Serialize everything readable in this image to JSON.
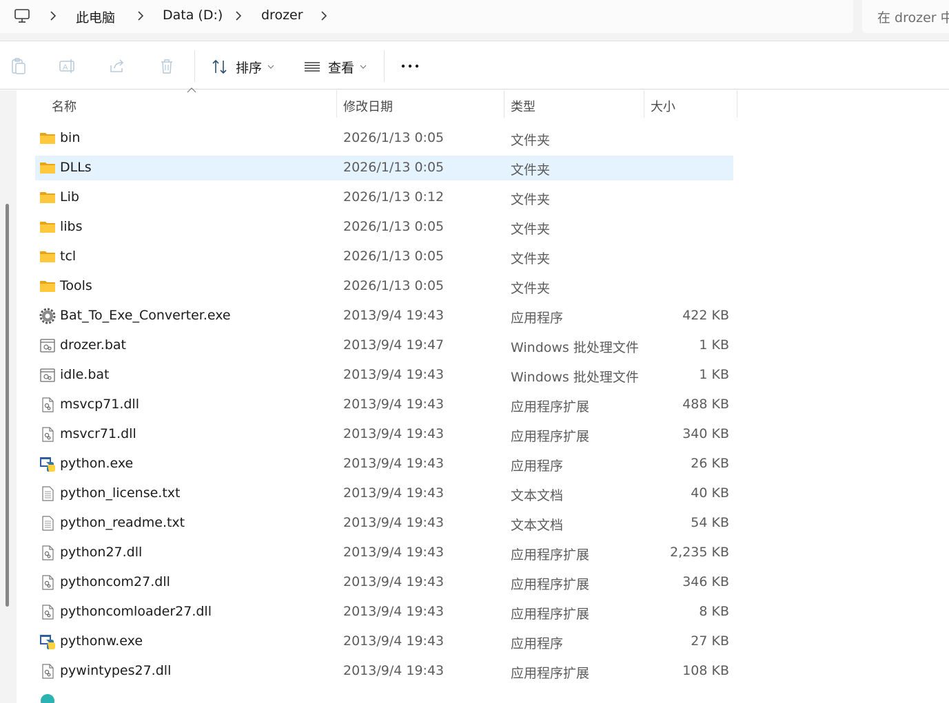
{
  "address_bar": {
    "crumbs": [
      "此电脑",
      "Data (D:)",
      "drozer"
    ],
    "search_placeholder": "在 drozer 中搜索"
  },
  "toolbar": {
    "sort_label": "排序",
    "view_label": "查看",
    "more_label": "更多选项"
  },
  "columns": {
    "name": "名称",
    "date": "修改日期",
    "type": "类型",
    "size": "大小"
  },
  "files": [
    {
      "name": "bin",
      "date": "2026/1/13 0:05",
      "type": "文件夹",
      "size": "",
      "icon": "folder-icon"
    },
    {
      "name": "DLLs",
      "date": "2026/1/13 0:05",
      "type": "文件夹",
      "size": "",
      "icon": "folder-icon",
      "selected": true
    },
    {
      "name": "Lib",
      "date": "2026/1/13 0:12",
      "type": "文件夹",
      "size": "",
      "icon": "folder-icon"
    },
    {
      "name": "libs",
      "date": "2026/1/13 0:05",
      "type": "文件夹",
      "size": "",
      "icon": "folder-icon"
    },
    {
      "name": "tcl",
      "date": "2026/1/13 0:05",
      "type": "文件夹",
      "size": "",
      "icon": "folder-icon"
    },
    {
      "name": "Tools",
      "date": "2026/1/13 0:05",
      "type": "文件夹",
      "size": "",
      "icon": "folder-icon"
    },
    {
      "name": "Bat_To_Exe_Converter.exe",
      "date": "2013/9/4 19:43",
      "type": "应用程序",
      "size": "422 KB",
      "icon": "gear-app-icon"
    },
    {
      "name": "drozer.bat",
      "date": "2013/9/4 19:47",
      "type": "Windows 批处理文件",
      "size": "1 KB",
      "icon": "batch-file-icon"
    },
    {
      "name": "idle.bat",
      "date": "2013/9/4 19:43",
      "type": "Windows 批处理文件",
      "size": "1 KB",
      "icon": "batch-file-icon"
    },
    {
      "name": "msvcp71.dll",
      "date": "2013/9/4 19:43",
      "type": "应用程序扩展",
      "size": "488 KB",
      "icon": "dll-file-icon"
    },
    {
      "name": "msvcr71.dll",
      "date": "2013/9/4 19:43",
      "type": "应用程序扩展",
      "size": "340 KB",
      "icon": "dll-file-icon"
    },
    {
      "name": "python.exe",
      "date": "2013/9/4 19:43",
      "type": "应用程序",
      "size": "26 KB",
      "icon": "python-icon"
    },
    {
      "name": "python_license.txt",
      "date": "2013/9/4 19:43",
      "type": "文本文档",
      "size": "40 KB",
      "icon": "text-file-icon"
    },
    {
      "name": "python_readme.txt",
      "date": "2013/9/4 19:43",
      "type": "文本文档",
      "size": "54 KB",
      "icon": "text-file-icon"
    },
    {
      "name": "python27.dll",
      "date": "2013/9/4 19:43",
      "type": "应用程序扩展",
      "size": "2,235 KB",
      "icon": "dll-file-icon"
    },
    {
      "name": "pythoncom27.dll",
      "date": "2013/9/4 19:43",
      "type": "应用程序扩展",
      "size": "346 KB",
      "icon": "dll-file-icon"
    },
    {
      "name": "pythoncomloader27.dll",
      "date": "2013/9/4 19:43",
      "type": "应用程序扩展",
      "size": "8 KB",
      "icon": "dll-file-icon"
    },
    {
      "name": "pythonw.exe",
      "date": "2013/9/4 19:43",
      "type": "应用程序",
      "size": "27 KB",
      "icon": "python-icon"
    },
    {
      "name": "pywintypes27.dll",
      "date": "2013/9/4 19:43",
      "type": "应用程序扩展",
      "size": "108 KB",
      "icon": "dll-file-icon"
    }
  ],
  "colors": {
    "selection": "#e5f3ff",
    "folder": "#ffc83d",
    "folder_dark": "#e8a317"
  }
}
